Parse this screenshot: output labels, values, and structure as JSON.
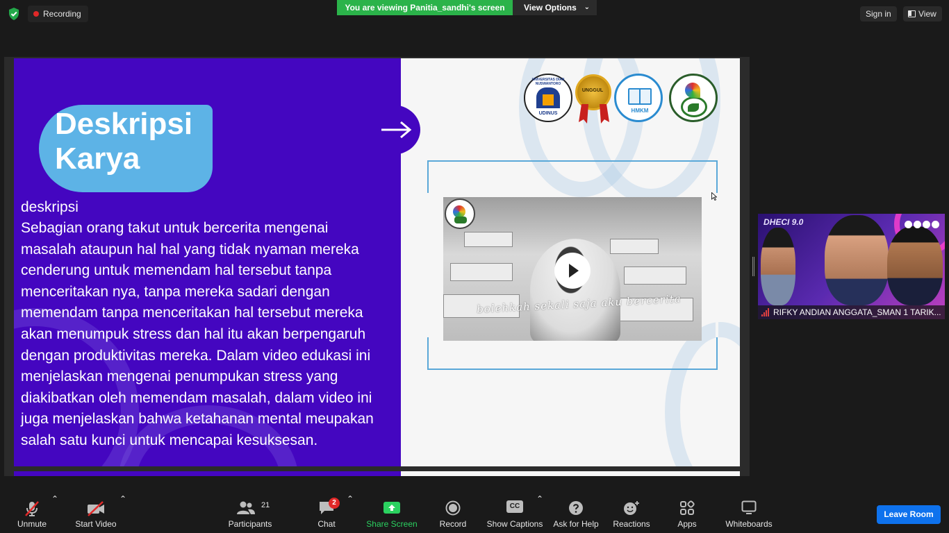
{
  "topbar": {
    "recording_label": "Recording",
    "viewing_banner": "You are viewing Panitia_sandhi's screen",
    "view_options_label": "View Options",
    "sign_in_label": "Sign in",
    "view_label": "View"
  },
  "slide": {
    "title_line1": "Deskripsi",
    "title_line2": "Karya",
    "desc_heading": "deskripsi",
    "desc_lines": [
      "Sebagian orang takut untuk bercerita mengenai",
      "masalah ataupun hal hal yang tidak nyaman mereka",
      "cenderung untuk memendam hal tersebut tanpa",
      "menceritakan nya, tanpa mereka sadari dengan",
      "memendam tanpa menceritakan hal tersebut mereka",
      "akan menumpuk stress dan hal itu akan berpengaruh",
      "dengan produktivitas mereka. Dalam video edukasi ini",
      "menjelaskan mengenai penumpukan stress yang",
      "diakibatkan oleh memendam masalah, dalam video ini",
      "juga menjelaskan bahwa ketahanan mental meupakan",
      "salah satu kunci untuk mencapai kesuksesan."
    ],
    "logos": {
      "logo1_text": "UNIVERSITAS DIAN NUSWANTORO",
      "logo1_sub": "UDINUS",
      "logo2_text": "UNGGUL",
      "logo3_text": "HMKM"
    },
    "video_caption": "bolehkah sekali saja aku bercerita"
  },
  "participant": {
    "overlay_title": "DHECI 9.0",
    "name": "RIFKY ANDIAN ANGGATA_SMAN 1 TARIK..."
  },
  "toolbar": {
    "unmute": "Unmute",
    "start_video": "Start Video",
    "participants": "Participants",
    "participants_count": "21",
    "chat": "Chat",
    "chat_badge": "2",
    "share_screen": "Share Screen",
    "record": "Record",
    "show_captions": "Show Captions",
    "captions_icon_text": "CC",
    "ask_for_help": "Ask for Help",
    "reactions": "Reactions",
    "apps": "Apps",
    "whiteboards": "Whiteboards",
    "leave_room": "Leave Room"
  },
  "colors": {
    "slide_purple": "#4406c0",
    "slide_blob_blue": "#5db3e6",
    "banner_green": "#2bb34a",
    "leave_blue": "#0e72ed",
    "share_green": "#2bd160",
    "badge_red": "#e02828"
  }
}
